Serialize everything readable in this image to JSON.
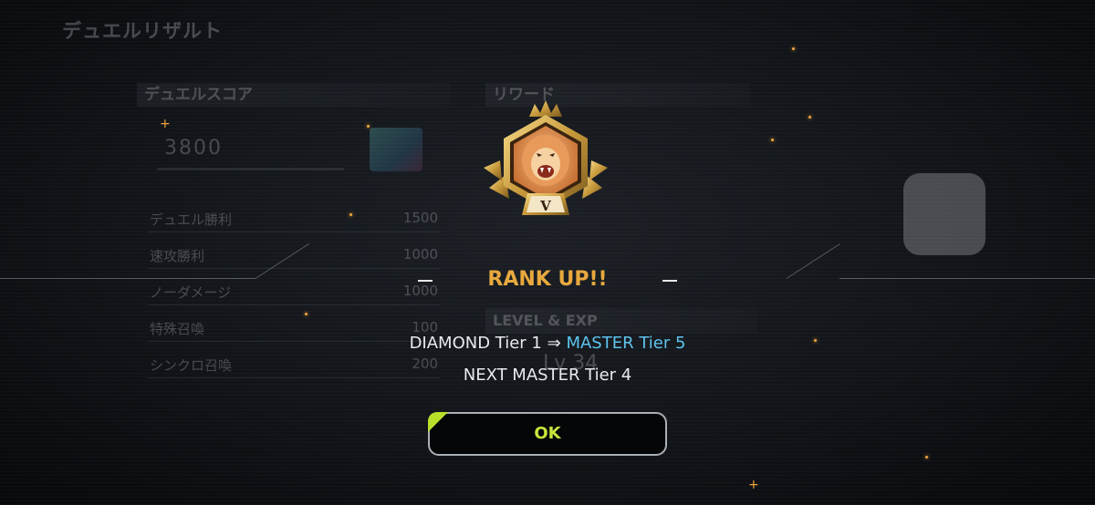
{
  "background": {
    "screen_title": "デュエルリザルト",
    "score_panel": {
      "header": "デュエルスコア",
      "total": "3800",
      "rows": [
        {
          "label": "デュエル勝利",
          "value": "1500"
        },
        {
          "label": "速攻勝利",
          "value": "1000"
        },
        {
          "label": "ノーダメージ",
          "value": "1000"
        },
        {
          "label": "特殊召喚",
          "value": "100"
        },
        {
          "label": "シンクロ召喚",
          "value": "200"
        }
      ]
    },
    "reward_panel": {
      "header": "リワード"
    },
    "level_panel": {
      "header": "LEVEL & EXP",
      "level": "Lv 34"
    }
  },
  "modal": {
    "emblem_icon": "master-lion-emblem-icon",
    "emblem_tier": "V",
    "title": "RANK UP!!",
    "rank_from": "DIAMOND Tier 1",
    "arrow": "⇒",
    "rank_to": "MASTER Tier 5",
    "next_rank": "NEXT MASTER Tier 4",
    "ok_label": "OK"
  },
  "colors": {
    "title_gold": "#e8a93e",
    "rank_to_blue": "#5fc3ef",
    "ok_green": "#c5e63c",
    "spark_orange": "#f2a640"
  }
}
